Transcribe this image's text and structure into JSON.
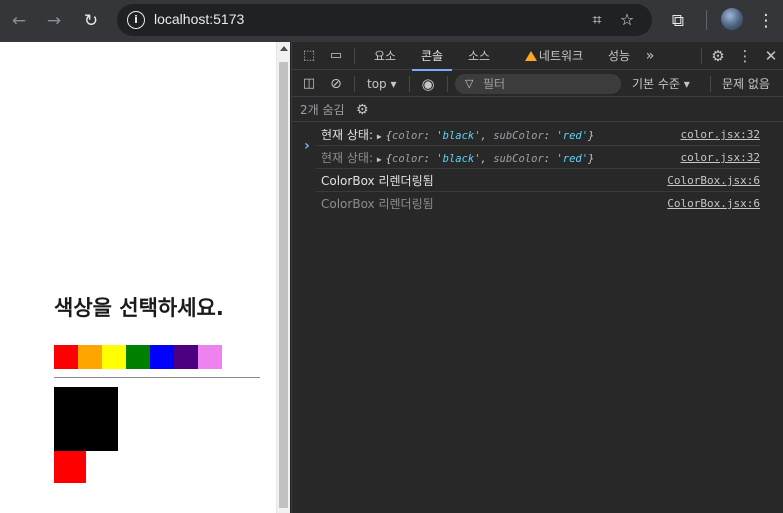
{
  "browser": {
    "url": "localhost:5173",
    "back_icon": "arrow-left-icon",
    "forward_icon": "arrow-right-icon",
    "reload_icon": "reload-icon"
  },
  "page": {
    "title": "색상을 선택하세요.",
    "swatches": [
      "#ff0000",
      "#ffa500",
      "#ffff00",
      "#008000",
      "#0000ff",
      "#4b0082",
      "#ee82ee"
    ],
    "color_box": "#000000",
    "sub_color_box": "#ff0000"
  },
  "devtools": {
    "tabs": [
      "요소",
      "콘솔",
      "소스",
      "네트워크",
      "성능"
    ],
    "selected_tab": "콘솔",
    "more_tabs": "»",
    "context": "top ▾",
    "filter_placeholder": "필터",
    "level": "기본 수준 ▾",
    "issues": "문제 없음",
    "hidden_count": "2개 숨김",
    "logs": [
      {
        "label": "현재 상태:",
        "obj": {
          "k1": "color",
          "v1": "'black'",
          "k2": "subColor",
          "v2": "'red'"
        },
        "source": "color.jsx:32",
        "dim": false
      },
      {
        "label": "현재 상태:",
        "obj": {
          "k1": "color",
          "v1": "'black'",
          "k2": "subColor",
          "v2": "'red'"
        },
        "source": "color.jsx:32",
        "dim": true
      },
      {
        "label": "ColorBox 리렌더링됨",
        "source": "ColorBox.jsx:6",
        "dim": false
      },
      {
        "label": "ColorBox 리렌더링됨",
        "source": "ColorBox.jsx:6",
        "dim": true
      }
    ],
    "prompt": "›"
  }
}
